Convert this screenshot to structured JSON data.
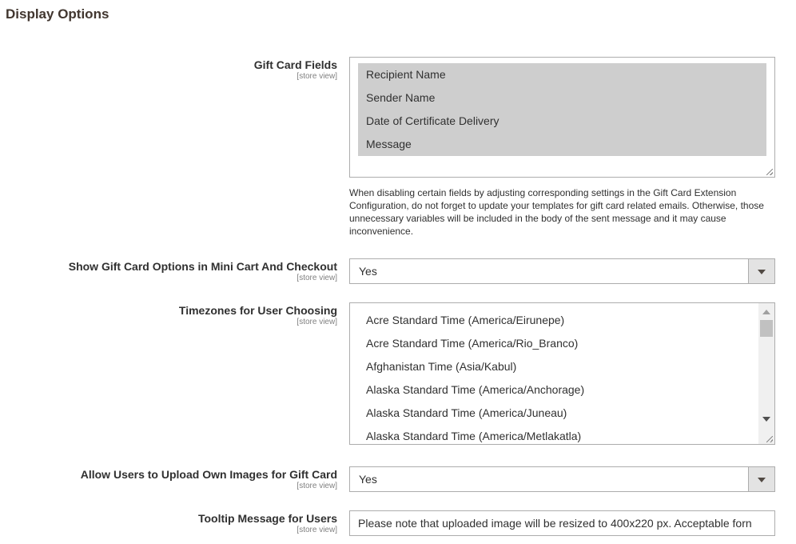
{
  "section_title": "Display Options",
  "fields": [
    {
      "label": "Gift Card Fields",
      "scope": "[store view]",
      "options": [
        "Recipient Name",
        "Sender Name",
        "Date of Certificate Delivery",
        "Message"
      ],
      "note": "When disabling certain fields by adjusting corresponding settings in the Gift Card Extension Configuration, do not forget to update your templates for gift card related emails. Otherwise, those unnecessary variables will be included in the body of the sent message and it may cause inconvenience."
    },
    {
      "label": "Show Gift Card Options in Mini Cart And Checkout",
      "scope": "[store view]",
      "value": "Yes"
    },
    {
      "label": "Timezones for User Choosing",
      "scope": "[store view]",
      "options": [
        "Acre Standard Time (America/Eirunepe)",
        "Acre Standard Time (America/Rio_Branco)",
        "Afghanistan Time (Asia/Kabul)",
        "Alaska Standard Time (America/Anchorage)",
        "Alaska Standard Time (America/Juneau)",
        "Alaska Standard Time (America/Metlakatla)"
      ]
    },
    {
      "label": "Allow Users to Upload Own Images for Gift Card",
      "scope": "[store view]",
      "value": "Yes"
    },
    {
      "label": "Tooltip Message for Users",
      "scope": "[store view]",
      "value": "Please note that uploaded image will be resized to 400x220 px. Acceptable forn"
    }
  ]
}
